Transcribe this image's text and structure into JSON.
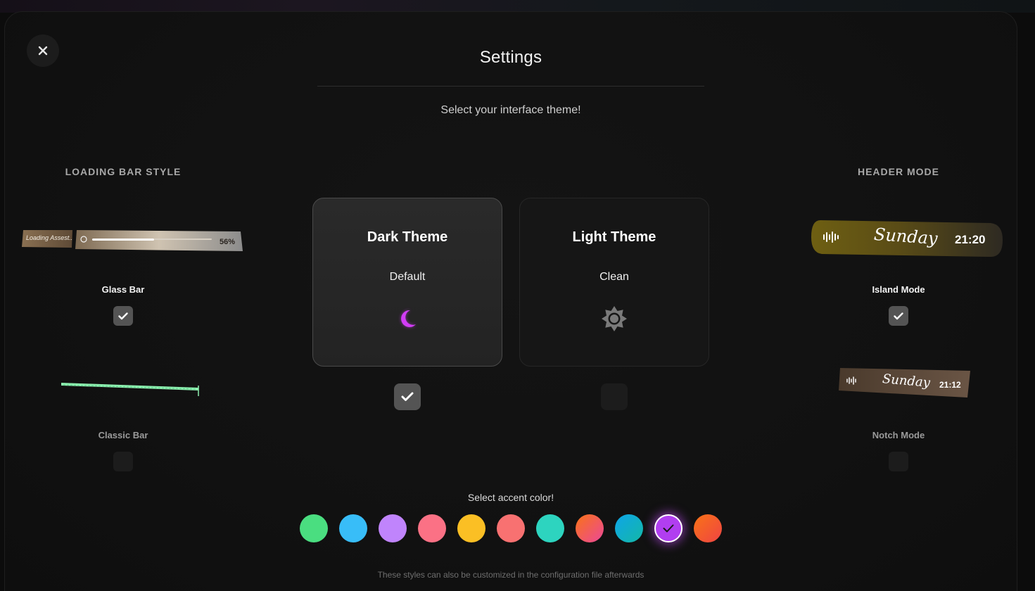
{
  "dialog": {
    "title": "Settings",
    "subtitle": "Select your interface theme!"
  },
  "loading_bar": {
    "heading": "LOADING BAR STYLE",
    "options": [
      {
        "label": "Glass Bar",
        "checked": true,
        "preview_text": "Loading Assest..",
        "preview_percent": "56%",
        "progress": 0.56
      },
      {
        "label": "Classic Bar",
        "checked": false
      }
    ]
  },
  "themes": [
    {
      "name": "Dark Theme",
      "description": "Default",
      "icon": "moon-icon",
      "selected": true,
      "icon_color": "#d23cf5"
    },
    {
      "name": "Light Theme",
      "description": "Clean",
      "icon": "sun-icon",
      "selected": false,
      "icon_color": "#7a7a7a"
    }
  ],
  "header_mode": {
    "heading": "HEADER MODE",
    "options": [
      {
        "label": "Island Mode",
        "checked": true,
        "preview_day": "Sunday",
        "preview_time": "21:20"
      },
      {
        "label": "Notch Mode",
        "checked": false,
        "preview_day": "Sunday",
        "preview_time": "21:12"
      }
    ]
  },
  "accent": {
    "label": "Select accent color!",
    "swatches": [
      {
        "name": "green",
        "color": "#4ade80"
      },
      {
        "name": "sky",
        "color": "#38bdf8"
      },
      {
        "name": "lavender",
        "color": "#c084fc"
      },
      {
        "name": "pink",
        "color": "#fb7185"
      },
      {
        "name": "amber",
        "color": "#fbbf24"
      },
      {
        "name": "coral",
        "color": "#f87171"
      },
      {
        "name": "teal",
        "color": "#2dd4bf"
      },
      {
        "name": "sunset",
        "color": "linear-gradient(135deg,#f97316,#ec4899)"
      },
      {
        "name": "ocean",
        "color": "linear-gradient(135deg,#0ea5e9,#14b8a6)"
      },
      {
        "name": "violet",
        "color": "#b13ef0",
        "selected": true
      },
      {
        "name": "flame",
        "color": "linear-gradient(135deg,#f97316,#ef4444)"
      }
    ]
  },
  "footer": {
    "note": "These styles can also be customized in the configuration file afterwards"
  }
}
